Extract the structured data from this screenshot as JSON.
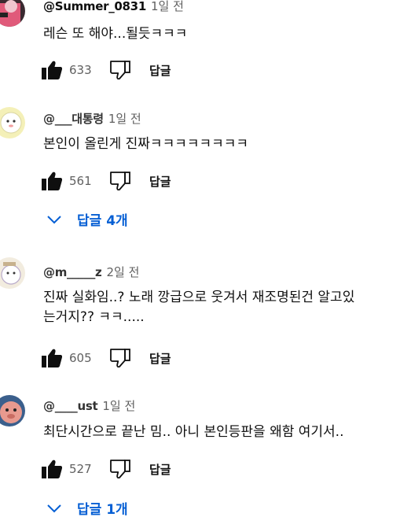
{
  "comments": [
    {
      "handle": "@Summer_0831",
      "time": "1일 전",
      "text": "레슨 또 해야...될듯ㅋㅋㅋ",
      "likes": "633",
      "reply_label": "답글"
    },
    {
      "handle": "@___대통령",
      "time": "1일 전",
      "text": "본인이 올린게 진짜ㅋㅋㅋㅋㅋㅋㅋㅋ",
      "likes": "561",
      "reply_label": "답글",
      "replies_toggle": "답글 4개"
    },
    {
      "handle": "@m_____z",
      "time": "2일 전",
      "text_line1": "진짜 실화임..? 노래 깡급으로 웃겨서 재조명된건 알고있",
      "text_line2": "는거지?? ㅋㅋ.....",
      "likes": "605",
      "reply_label": "답글"
    },
    {
      "handle": "@____ust",
      "time": "1일 전",
      "text": "최단시간으로 끝난 밈.. 아니 본인등판을 왜함 여기서..",
      "likes": "527",
      "reply_label": "답글",
      "replies_toggle": "답글 1개"
    }
  ],
  "icons": {
    "like": "thumbs-up-filled-icon",
    "dislike": "thumbs-down-outline-icon",
    "expand": "chevron-down-icon"
  },
  "colors": {
    "link_blue": "#065fd4",
    "secondary_text": "#606060",
    "primary_text": "#0f0f0f"
  }
}
